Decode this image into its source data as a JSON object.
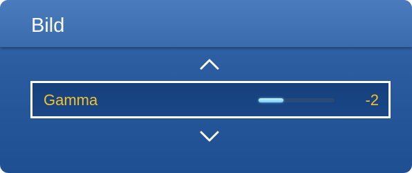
{
  "header": {
    "title": "Bild"
  },
  "setting": {
    "label": "Gamma",
    "value": "-2",
    "slider_fraction": 0.33
  },
  "nav": {
    "up_icon": "chevron-up-icon",
    "down_icon": "chevron-down-icon"
  },
  "colors": {
    "accent": "#f2c12e",
    "panel": "#2a5a9e"
  }
}
